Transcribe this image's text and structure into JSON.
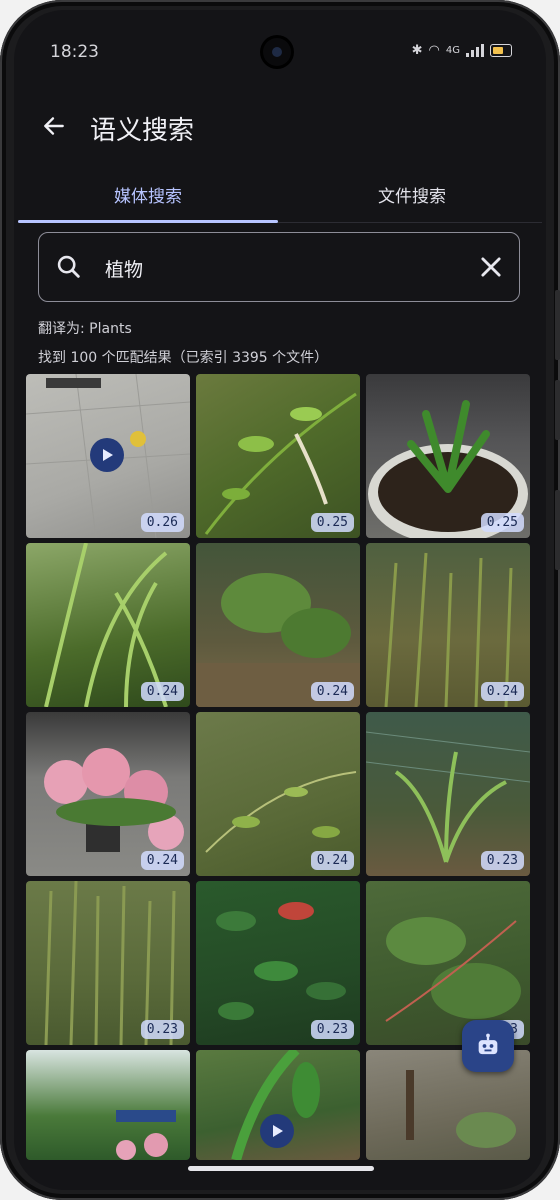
{
  "status_bar": {
    "time": "18:23",
    "network_label": "4G"
  },
  "app_bar": {
    "title": "语义搜索",
    "back_icon": "arrow-left-icon"
  },
  "tabs": [
    {
      "label": "媒体搜索",
      "selected": true
    },
    {
      "label": "文件搜索",
      "selected": false
    }
  ],
  "search": {
    "value": "植物",
    "placeholder": "",
    "search_icon": "search-icon",
    "clear_icon": "close-icon"
  },
  "translation_text": "翻译为: Plants",
  "results_summary": "找到 100 个匹配结果（已索引 3395 个文件）",
  "results": [
    {
      "score": "0.26",
      "is_video": true
    },
    {
      "score": "0.25",
      "is_video": false
    },
    {
      "score": "0.25",
      "is_video": false
    },
    {
      "score": "0.24",
      "is_video": false
    },
    {
      "score": "0.24",
      "is_video": false
    },
    {
      "score": "0.24",
      "is_video": false
    },
    {
      "score": "0.24",
      "is_video": false
    },
    {
      "score": "0.24",
      "is_video": false
    },
    {
      "score": "0.23",
      "is_video": false
    },
    {
      "score": "0.23",
      "is_video": false
    },
    {
      "score": "0.23",
      "is_video": false
    },
    {
      "score": "0.23",
      "is_video": false
    },
    {
      "score": "",
      "is_video": false
    },
    {
      "score": "",
      "is_video": true
    },
    {
      "score": "",
      "is_video": false
    }
  ],
  "fab": {
    "icon": "robot-icon"
  },
  "colors": {
    "accent": "#b7c4ff",
    "background": "#141417",
    "score_badge": "#d2dcff",
    "fab": "#2a4488"
  }
}
